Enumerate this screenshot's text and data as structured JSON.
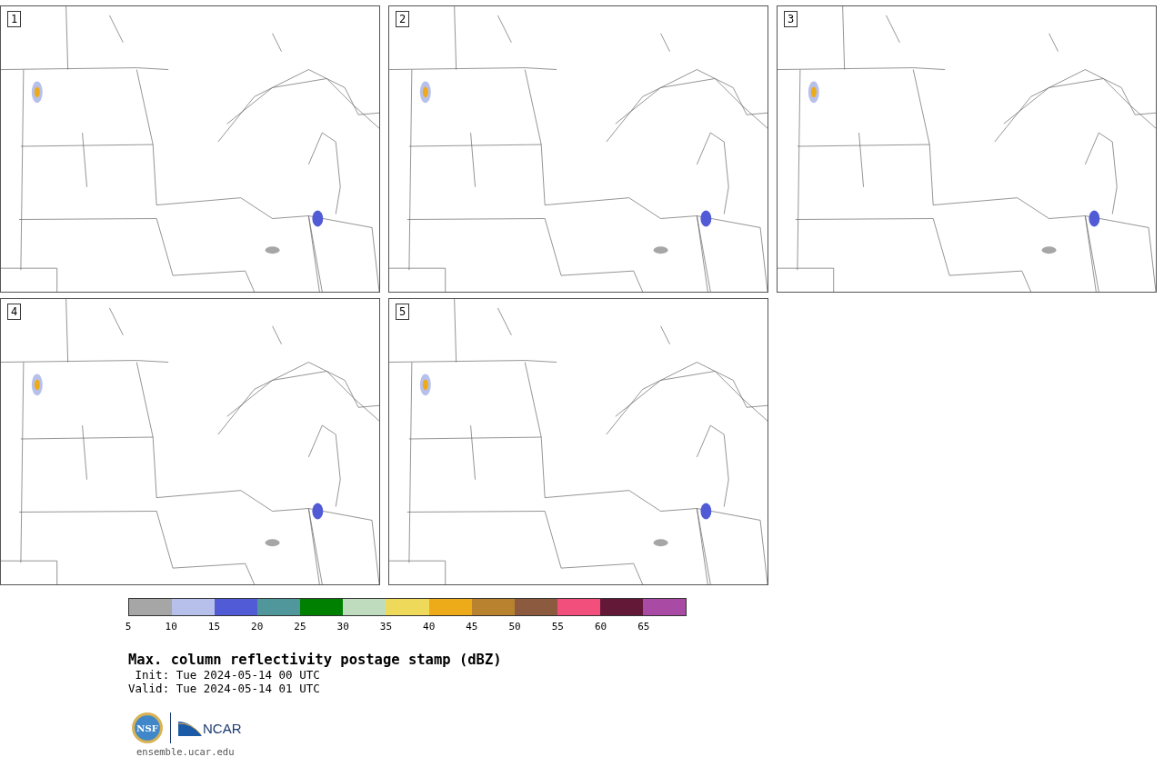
{
  "panels": [
    {
      "label": "1"
    },
    {
      "label": "2"
    },
    {
      "label": "3"
    },
    {
      "label": "4"
    },
    {
      "label": "5"
    }
  ],
  "colorbar": {
    "bins": [
      {
        "color": "#a6a6a6"
      },
      {
        "color": "#b7c0ea"
      },
      {
        "color": "#525bd6"
      },
      {
        "color": "#4f979b"
      },
      {
        "color": "#008000"
      },
      {
        "color": "#bfdcbf"
      },
      {
        "color": "#efd95b"
      },
      {
        "color": "#eeab19"
      },
      {
        "color": "#b9822f"
      },
      {
        "color": "#8b5a3f"
      },
      {
        "color": "#f24f7c"
      },
      {
        "color": "#631838"
      },
      {
        "color": "#a94ba4"
      }
    ],
    "ticks": [
      "5",
      "10",
      "15",
      "20",
      "25",
      "30",
      "35",
      "40",
      "45",
      "50",
      "55",
      "60",
      "65"
    ]
  },
  "title": "Max. column reflectivity postage stamp (dBZ)",
  "init": " Init: Tue 2024-05-14 00 UTC",
  "valid": "Valid: Tue 2024-05-14 01 UTC",
  "logos": {
    "nsf": "NSF",
    "ncar": "NCAR"
  },
  "url": "ensemble.ucar.edu"
}
